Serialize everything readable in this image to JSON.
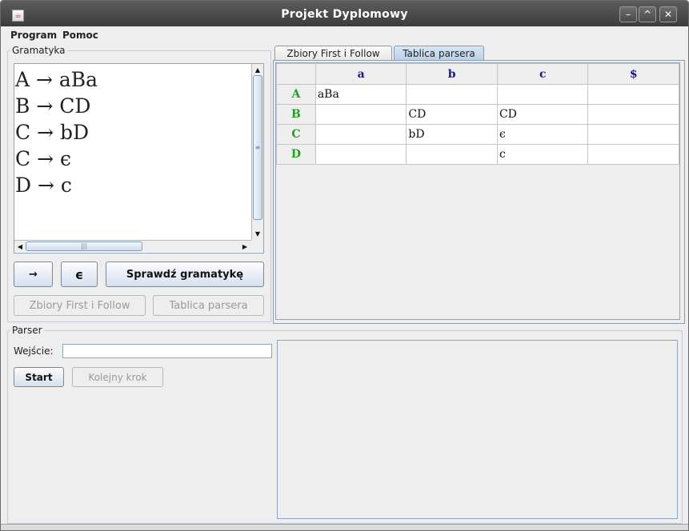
{
  "window": {
    "title": "Projekt Dyplomowy",
    "controls": [
      "minimize-icon",
      "maximize-icon",
      "close-icon"
    ],
    "control_glyphs": {
      "minimize": "–",
      "maximize": "^",
      "close": "✕"
    }
  },
  "menu": {
    "items": [
      {
        "label": "Program"
      },
      {
        "label": "Pomoc"
      }
    ]
  },
  "grammar": {
    "group_title": "Gramatyka",
    "rules": [
      "A → aBa",
      "B → CD",
      "C → bD",
      "C → ϵ",
      "D → c"
    ],
    "arrow_button": "→",
    "epsilon_button": "ϵ",
    "check_button": "Sprawdź gramatykę",
    "first_follow_button": "Zbiory First i Follow",
    "parse_table_button": "Tablica parsera"
  },
  "tabs": [
    {
      "label": "Zbiory First i Follow",
      "active": false
    },
    {
      "label": "Tablica parsera",
      "active": true
    }
  ],
  "parse_table": {
    "columns": [
      "a",
      "b",
      "c",
      "$"
    ],
    "rows": [
      {
        "nonterminal": "A",
        "cells": [
          "aBa",
          "",
          "",
          ""
        ]
      },
      {
        "nonterminal": "B",
        "cells": [
          "",
          "CD",
          "CD",
          ""
        ]
      },
      {
        "nonterminal": "C",
        "cells": [
          "",
          "bD",
          "ϵ",
          ""
        ]
      },
      {
        "nonterminal": "D",
        "cells": [
          "",
          "",
          "c",
          ""
        ]
      }
    ]
  },
  "parser": {
    "group_title": "Parser",
    "input_label": "Wejście:",
    "input_value": "",
    "start_button": "Start",
    "next_step_button": "Kolejny krok"
  },
  "colors": {
    "titlebar": "#4a4a4a",
    "active_tab": "#b8cfe9",
    "nonterminal": "#22a022",
    "terminal_header": "#1b1b7a"
  }
}
